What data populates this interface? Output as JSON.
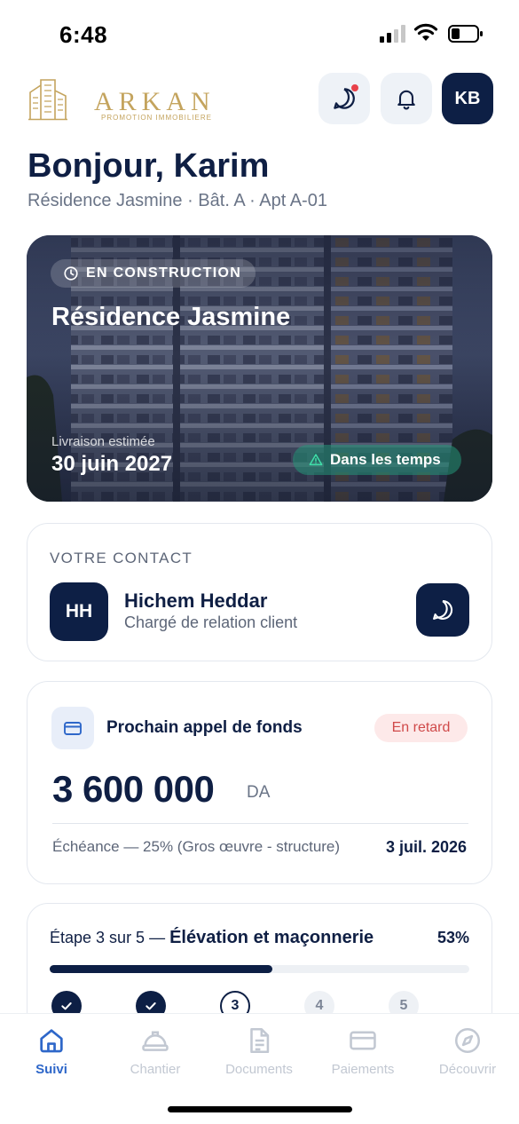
{
  "status_bar": {
    "time": "6:48"
  },
  "brand": {
    "name": "ARKAN",
    "tagline": "PROMOTION IMMOBILIERE",
    "color": "#c4a45e"
  },
  "header": {
    "chat_icon": "chat-bubble-icon",
    "notifications_icon": "bell-icon",
    "user_initials": "KB"
  },
  "greeting": {
    "title": "Bonjour, Karim",
    "subtitle": "Résidence Jasmine · Bât. A · Apt A-01"
  },
  "project": {
    "status": "EN CONSTRUCTION",
    "name": "Résidence Jasmine",
    "delivery_label": "Livraison estimée",
    "delivery_date": "30 juin 2027",
    "schedule_status": "Dans les temps"
  },
  "contact": {
    "section_label": "VOTRE CONTACT",
    "initials": "HH",
    "name": "Hichem Heddar",
    "role": "Chargé de relation client"
  },
  "payment": {
    "title": "Prochain appel de fonds",
    "badge": "En retard",
    "amount": "3 600 000",
    "currency": "DA",
    "due_label": "Échéance — 25% (Gros œuvre - structure)",
    "due_date": "3 juil. 2026"
  },
  "stage": {
    "label": "Étape 3 sur 5 —",
    "name": "Élévation et maçonnerie",
    "percent_text": "53%",
    "progress": 0.53,
    "current_step": 3,
    "steps": [
      {
        "label": "",
        "state": "done"
      },
      {
        "label": "",
        "state": "done"
      },
      {
        "label": "3",
        "state": "current"
      },
      {
        "label": "4",
        "state": "todo"
      },
      {
        "label": "5",
        "state": "todo"
      }
    ]
  },
  "tabs": [
    {
      "label": "Suivi",
      "icon": "home-icon",
      "active": true
    },
    {
      "label": "Chantier",
      "icon": "hard-hat-icon",
      "active": false
    },
    {
      "label": "Documents",
      "icon": "document-icon",
      "active": false
    },
    {
      "label": "Paiements",
      "icon": "credit-card-icon",
      "active": false
    },
    {
      "label": "Découvrir",
      "icon": "compass-icon",
      "active": false
    }
  ],
  "colors": {
    "navy": "#0d1f45",
    "accent_blue": "#2e67c9",
    "late_red": "#d04a4a",
    "ontime_green": "#249678",
    "notification_dot": "#e8414a"
  }
}
